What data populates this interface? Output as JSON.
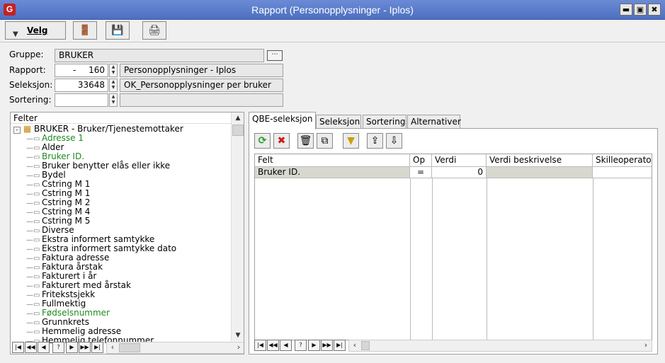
{
  "window": {
    "title": "Rapport (Personopplysninger - Iplos)",
    "app_icon": "G"
  },
  "toolbar": {
    "velg_label": "Velg"
  },
  "form": {
    "gruppe_label": "Gruppe:",
    "gruppe_value": "BRUKER",
    "rapport_label": "Rapport:",
    "rapport_prefix": "-",
    "rapport_number": "160",
    "rapport_name": "Personopplysninger - Iplos",
    "seleksjon_label": "Seleksjon:",
    "seleksjon_number": "33648",
    "seleksjon_name": "OK_Personopplysninger per bruker",
    "sortering_label": "Sortering:",
    "sortering_number": "",
    "sortering_name": ""
  },
  "tree": {
    "header": "Felter",
    "root": "BRUKER - Bruker/Tjenestemottaker",
    "items": [
      {
        "label": "Adresse 1",
        "green": true
      },
      {
        "label": "Alder",
        "green": false
      },
      {
        "label": "Bruker ID.",
        "green": true
      },
      {
        "label": "Bruker benytter elås eller ikke",
        "green": false
      },
      {
        "label": "Bydel",
        "green": false
      },
      {
        "label": "Cstring M 1",
        "green": false
      },
      {
        "label": "Cstring M 1",
        "green": false
      },
      {
        "label": "Cstring M 2",
        "green": false
      },
      {
        "label": "Cstring M 4",
        "green": false
      },
      {
        "label": "Cstring M 5",
        "green": false
      },
      {
        "label": "Diverse",
        "green": false
      },
      {
        "label": "Ekstra informert samtykke",
        "green": false
      },
      {
        "label": "Ekstra informert samtykke dato",
        "green": false
      },
      {
        "label": "Faktura adresse",
        "green": false
      },
      {
        "label": "Faktura årstak",
        "green": false
      },
      {
        "label": "Fakturert i år",
        "green": false
      },
      {
        "label": "Fakturert med årstak",
        "green": false
      },
      {
        "label": "Fritekstsjekk",
        "green": false
      },
      {
        "label": "Fullmektig",
        "green": false
      },
      {
        "label": "Fødselsnummer",
        "green": true
      },
      {
        "label": "Grunnkrets",
        "green": false
      },
      {
        "label": "Hemmelig adresse",
        "green": false
      },
      {
        "label": "Hemmelig telefonnummer",
        "green": false
      }
    ]
  },
  "tabs": [
    "QBE-seleksjon",
    "Seleksjon",
    "Sortering",
    "Alternativer"
  ],
  "grid": {
    "columns": [
      "Felt",
      "Op",
      "Verdi",
      "Verdi beskrivelse",
      "Skilleoperator"
    ],
    "rows": [
      {
        "felt": "Bruker ID.",
        "op": "=",
        "verdi": "0",
        "beskrivelse": "",
        "skille": ""
      }
    ]
  }
}
